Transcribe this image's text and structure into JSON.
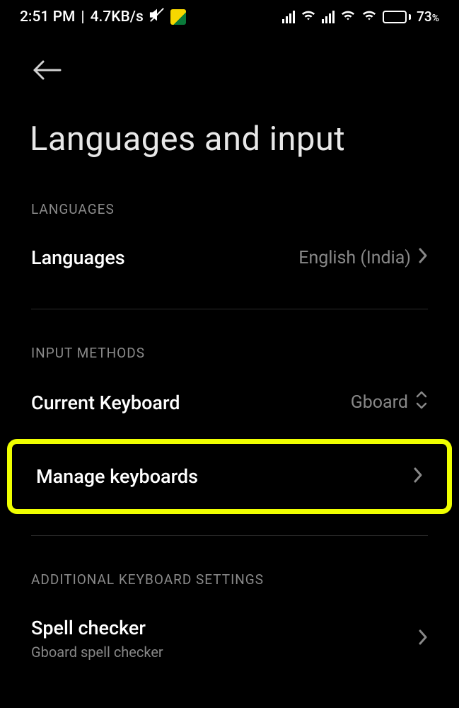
{
  "status": {
    "time": "2:51 PM",
    "net_speed": "4.7KB/s",
    "battery": "73",
    "battery_sym": "%"
  },
  "title": "Languages and input",
  "sections": {
    "languages": {
      "header": "LANGUAGES",
      "row_languages": {
        "label": "Languages",
        "value": "English (India)"
      }
    },
    "input_methods": {
      "header": "INPUT METHODS",
      "row_current_keyboard": {
        "label": "Current Keyboard",
        "value": "Gboard"
      },
      "row_manage_keyboards": {
        "label": "Manage keyboards"
      }
    },
    "additional": {
      "header": "ADDITIONAL KEYBOARD SETTINGS",
      "row_spell_checker": {
        "label": "Spell checker",
        "sub": "Gboard spell checker"
      }
    }
  }
}
